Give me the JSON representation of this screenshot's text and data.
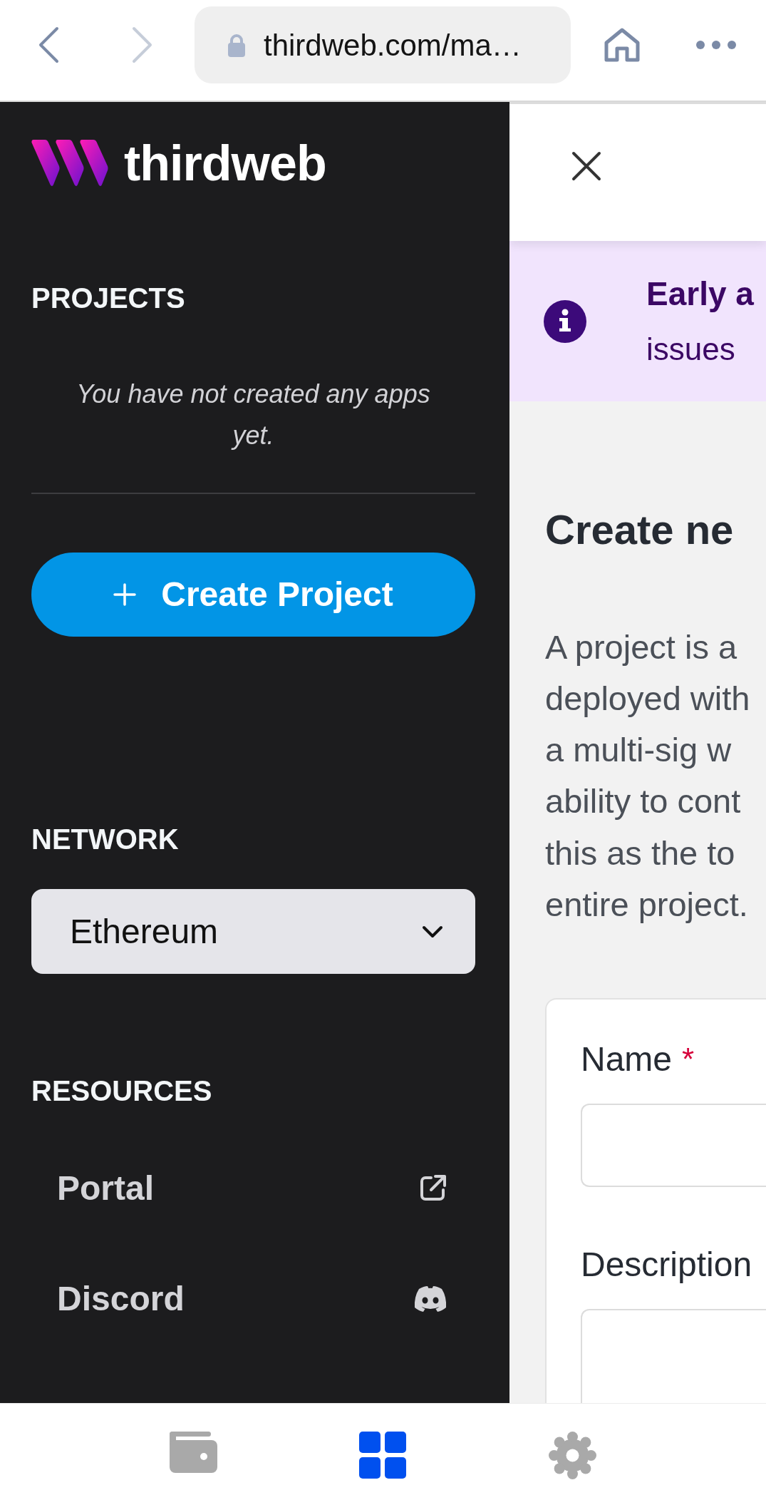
{
  "browser": {
    "nav_buttons": [
      {
        "kind": "back",
        "disabled": false
      },
      {
        "kind": "forward",
        "disabled": true
      }
    ],
    "url": "thirdweb.com/ma…"
  },
  "sidebar": {
    "logo_text": "thirdweb",
    "projects": {
      "heading": "PROJECTS",
      "empty_message": "You have not created any apps yet.",
      "create_button": "Create Project"
    },
    "network": {
      "heading": "NETWORK",
      "value": "Ethereum"
    },
    "resources": {
      "heading": "RESOURCES",
      "links": [
        {
          "label": "Portal",
          "kind": "external"
        },
        {
          "label": "Discord",
          "kind": "discord"
        }
      ]
    }
  },
  "panel": {
    "banner": {
      "title": "Early a",
      "text": "issues"
    },
    "title": "Create ne",
    "intro_lines": [
      "A project is a",
      "deployed with",
      "a multi-sig w",
      "ability to cont",
      "this as the to",
      "entire project."
    ],
    "form": {
      "fields": [
        {
          "kind": "input",
          "label": "Name",
          "required_mark": "*"
        },
        {
          "kind": "textarea",
          "label": "Description"
        }
      ]
    }
  },
  "bottom_nav": [
    {
      "kind": "wallet",
      "selected": false
    },
    {
      "kind": "apps",
      "selected": true
    },
    {
      "kind": "settings",
      "selected": false
    }
  ]
}
